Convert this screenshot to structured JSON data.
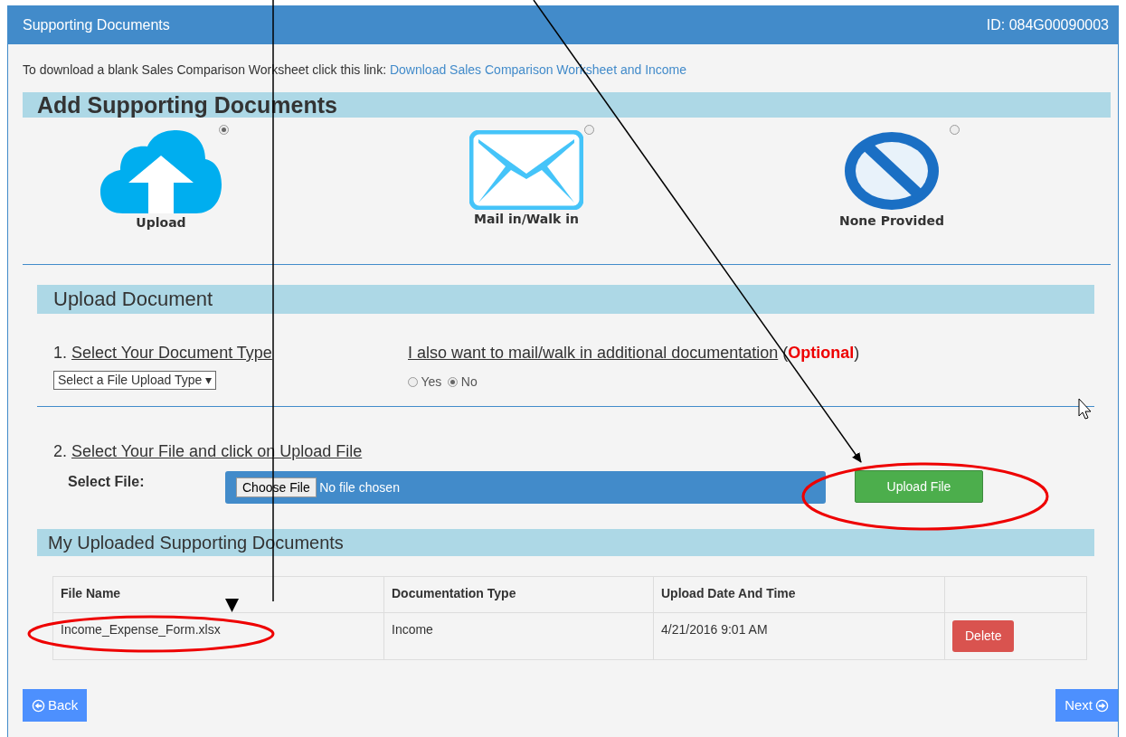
{
  "header": {
    "title": "Supporting Documents",
    "id_text": "ID: 084G00090003"
  },
  "intro": {
    "text": "To download a blank Sales Comparison Worksheet click this link:",
    "link": "Download Sales Comparison Worksheet and Income"
  },
  "add_section": {
    "title": "Add Supporting Documents",
    "options": [
      {
        "kind": "upload",
        "label": "Upload",
        "selected": true
      },
      {
        "kind": "mail",
        "label": "Mail in/Walk in",
        "selected": false
      },
      {
        "kind": "none",
        "label": "None Provided",
        "selected": false
      }
    ]
  },
  "upload_section": {
    "title": "Upload Document",
    "step1": {
      "number": "1.",
      "label": "Select Your Document Type",
      "select_value": "Select a File Upload Type ▾"
    },
    "mail_question": {
      "label": "I also want to mail/walk in additional documentation",
      "note": "(**Optional**)",
      "radios": [
        {
          "label": "Yes",
          "selected": false
        },
        {
          "label": "No",
          "selected": true
        }
      ]
    },
    "step2": {
      "number": "2.",
      "label": "Select Your File and click on Upload File",
      "field_label": "Select File:",
      "choose_button": "Choose File",
      "file_status": "No file chosen",
      "upload_button": "Upload File"
    }
  },
  "uploaded_section": {
    "title": "My Uploaded Supporting Documents",
    "table": {
      "columns": [
        "File Name",
        "Documentation Type",
        "Upload Date And Time"
      ],
      "rows": [
        {
          "file_name": "Income_Expense_Form.xlsx",
          "doc_type": "Income",
          "date": "4/21/2016 9:01 AM",
          "action": "Delete"
        }
      ]
    }
  },
  "footer": {
    "back": "Back",
    "next": "Next"
  }
}
